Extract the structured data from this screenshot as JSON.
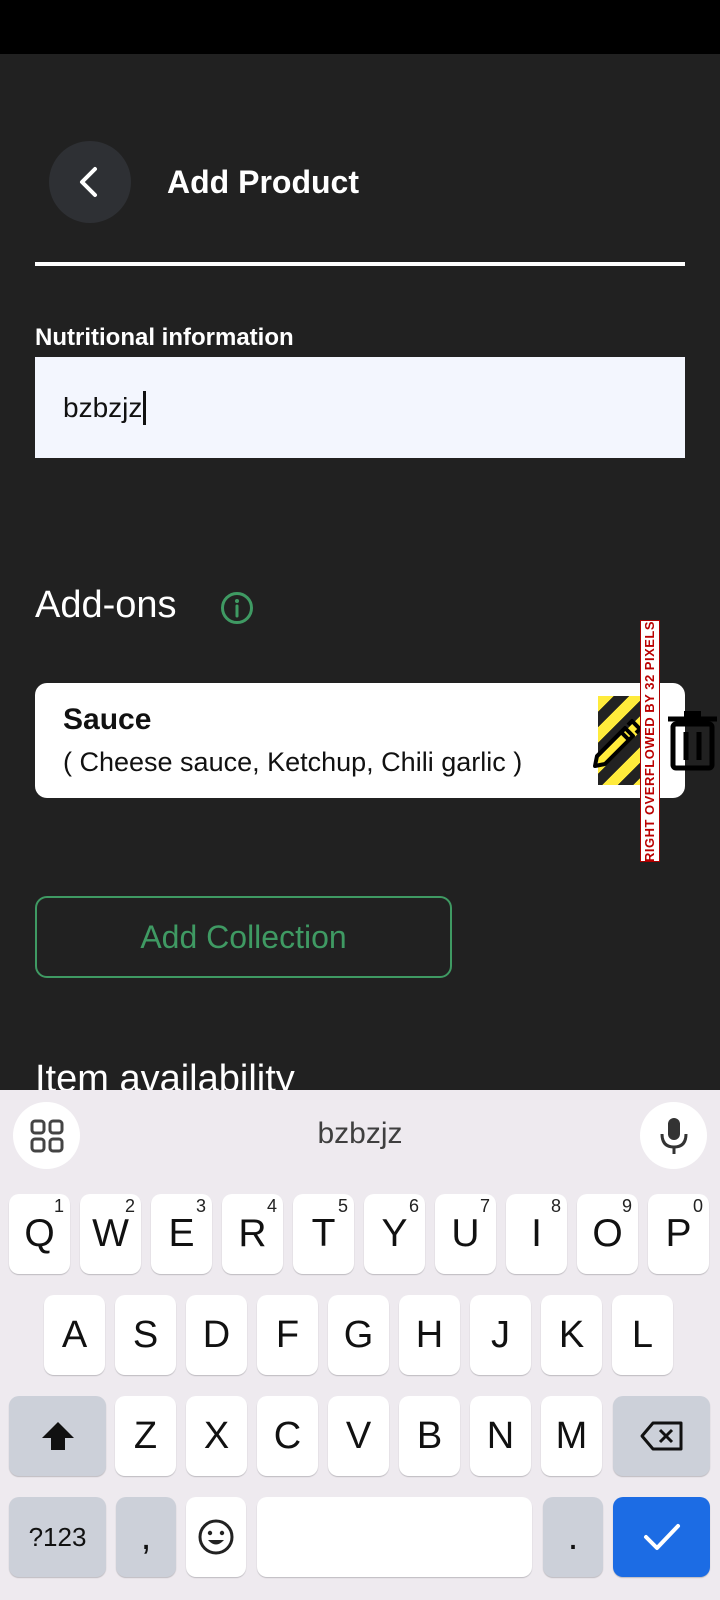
{
  "header": {
    "title": "Add Product"
  },
  "nutrition": {
    "label": "Nutritional information",
    "value": "bzbzjz"
  },
  "addons": {
    "title": "Add-ons",
    "items": [
      {
        "name": "Sauce",
        "options": "( Cheese sauce, Ketchup, Chili garlic  )"
      }
    ]
  },
  "overflow_warning": "RIGHT OVERFLOWED BY 32 PIXELS",
  "collection_button": "Add Collection",
  "availability": {
    "label": "Item availability"
  },
  "keyboard": {
    "suggestion": "bzbzjz",
    "row1": [
      {
        "k": "Q",
        "n": "1"
      },
      {
        "k": "W",
        "n": "2"
      },
      {
        "k": "E",
        "n": "3"
      },
      {
        "k": "R",
        "n": "4"
      },
      {
        "k": "T",
        "n": "5"
      },
      {
        "k": "Y",
        "n": "6"
      },
      {
        "k": "U",
        "n": "7"
      },
      {
        "k": "I",
        "n": "8"
      },
      {
        "k": "O",
        "n": "9"
      },
      {
        "k": "P",
        "n": "0"
      }
    ],
    "row2": [
      "A",
      "S",
      "D",
      "F",
      "G",
      "H",
      "J",
      "K",
      "L"
    ],
    "row3": [
      "Z",
      "X",
      "C",
      "V",
      "B",
      "N",
      "M"
    ],
    "symbols_key": "?123",
    "comma_key": ",",
    "period_key": "."
  },
  "colors": {
    "accent": "#3f9a63",
    "background": "#212121",
    "enter": "#1c6ce4"
  }
}
